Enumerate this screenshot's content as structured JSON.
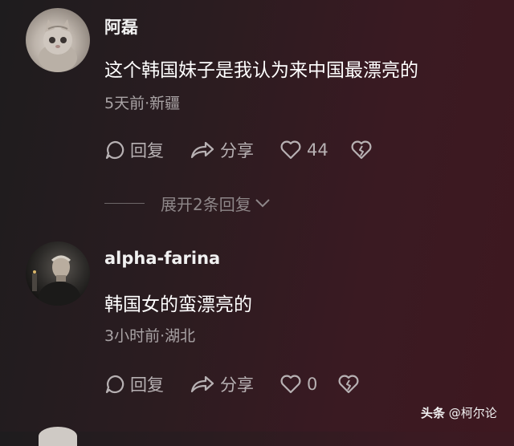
{
  "comments": [
    {
      "username": "阿磊",
      "text": "这个韩国妹子是我认为来中国最漂亮的",
      "meta": "5天前·新疆",
      "reply_label": "回复",
      "share_label": "分享",
      "like_count": "44"
    },
    {
      "username": "alpha-farina",
      "text": "韩国女的蛮漂亮的",
      "meta": "3小时前·湖北",
      "reply_label": "回复",
      "share_label": "分享",
      "like_count": "0"
    }
  ],
  "expand_replies": "展开2条回复",
  "watermark": {
    "brand": "头条",
    "handle": "@柯尔论"
  },
  "colors": {
    "background": "#2c1c20",
    "action_text": "#b7b1b3",
    "meta_text": "#a9a3a5"
  }
}
